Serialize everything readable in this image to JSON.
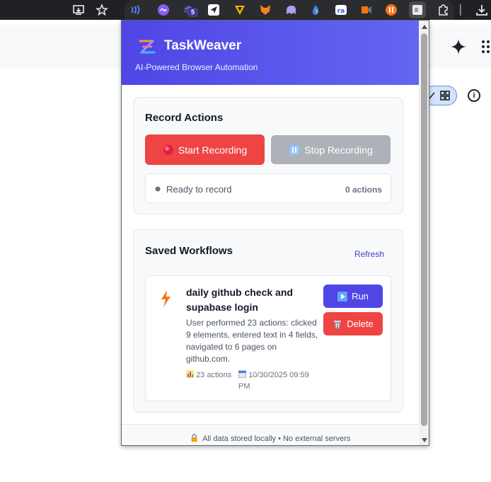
{
  "app": {
    "title": "TaskWeaver",
    "subtitle": "AI-Powered Browser Automation"
  },
  "record": {
    "section_title": "Record Actions",
    "start_label": "Start Recording",
    "stop_label": "Stop Recording",
    "status_text": "Ready to record",
    "actions_count": "0 actions"
  },
  "workflows": {
    "section_title": "Saved Workflows",
    "refresh_label": "Refresh",
    "items": [
      {
        "title": "daily github check and supabase login",
        "description": "User performed 23 actions: clicked 9 elements, entered text in 4 fields, navigated to 6 pages on github.com.",
        "actions": "23 actions",
        "date": "10/30/2025 09:59 PM",
        "run_label": "Run",
        "delete_label": "Delete"
      }
    ]
  },
  "footer": {
    "text": "All data stored locally • No external servers"
  },
  "browser": {
    "extension_badge": "5"
  },
  "colors": {
    "header": "#4f46e5",
    "start": "#ef4444",
    "stop": "#aeb1b7",
    "run": "#4f46e5",
    "delete": "#ef4444"
  }
}
